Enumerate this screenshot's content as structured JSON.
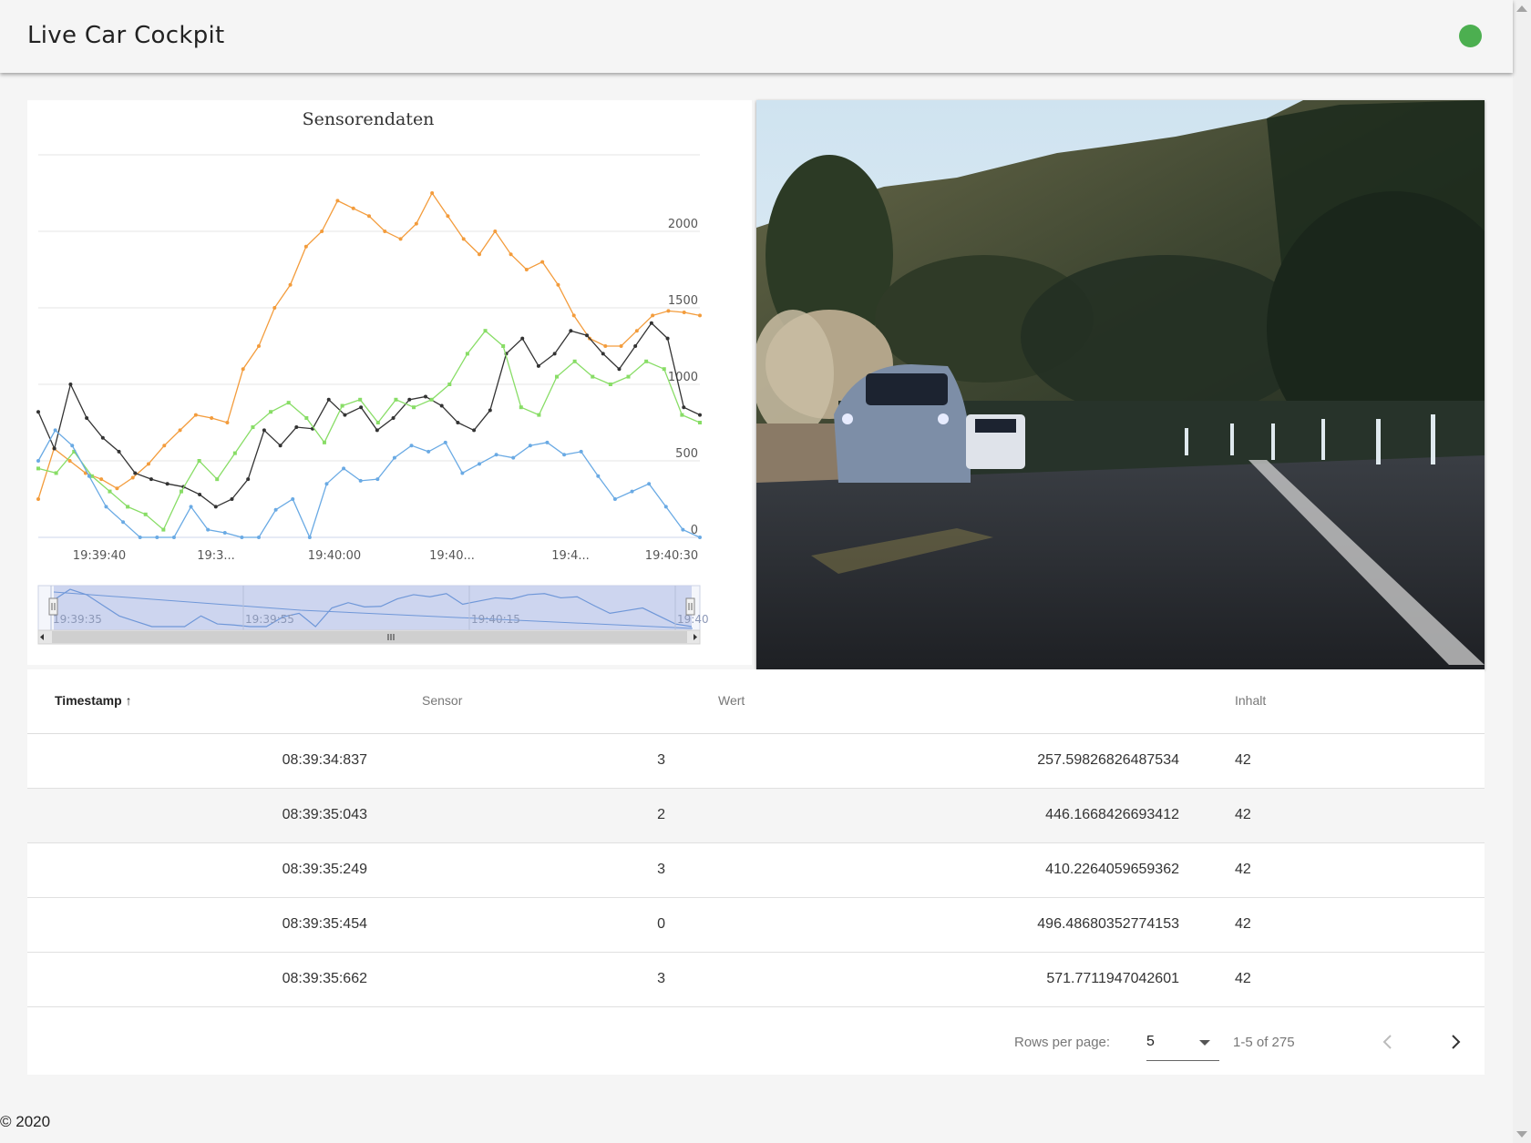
{
  "app": {
    "title": "Live Car Cockpit",
    "status_color": "#4caf50"
  },
  "chart_data": {
    "type": "line",
    "title": "Sensorendaten",
    "xlabel": "",
    "ylabel": "",
    "y_ticks": [
      "0",
      "500",
      "1000",
      "1500",
      "2000"
    ],
    "x_ticks": [
      "19:39:40",
      "19:3...",
      "19:40:00",
      "19:40...",
      "19:4...",
      "19:40:30"
    ],
    "ylim": [
      0,
      2500
    ],
    "grid": true,
    "legend": "none",
    "series": [
      {
        "color": "#f39c3c",
        "values": [
          250,
          580,
          500,
          420,
          380,
          320,
          390,
          480,
          600,
          700,
          800,
          780,
          750,
          1100,
          1250,
          1500,
          1650,
          1900,
          2000,
          2200,
          2150,
          2100,
          2000,
          1950,
          2050,
          2250,
          2100,
          1950,
          1850,
          2000,
          1850,
          1750,
          1800,
          1650,
          1450,
          1300,
          1250,
          1250,
          1350,
          1450,
          1480,
          1470,
          1450
        ]
      },
      {
        "color": "#333333",
        "values": [
          820,
          580,
          1000,
          780,
          650,
          560,
          420,
          380,
          350,
          330,
          280,
          200,
          250,
          380,
          700,
          600,
          720,
          710,
          900,
          800,
          850,
          700,
          780,
          900,
          920,
          860,
          750,
          700,
          830,
          1200,
          1300,
          1120,
          1200,
          1350,
          1320,
          1200,
          1100,
          1250,
          1400,
          1300,
          850,
          800
        ]
      },
      {
        "color": "#88dd66",
        "values": [
          450,
          420,
          560,
          400,
          300,
          200,
          150,
          50,
          300,
          500,
          380,
          550,
          720,
          820,
          880,
          780,
          620,
          860,
          900,
          750,
          900,
          850,
          900,
          1000,
          1200,
          1350,
          1250,
          850,
          800,
          1050,
          1150,
          1050,
          1000,
          1050,
          1150,
          1100,
          800,
          750
        ]
      },
      {
        "color": "#6aaae4",
        "values": [
          500,
          700,
          600,
          400,
          200,
          100,
          0,
          0,
          0,
          200,
          50,
          30,
          0,
          0,
          180,
          250,
          0,
          350,
          450,
          370,
          380,
          520,
          600,
          560,
          620,
          420,
          480,
          540,
          520,
          600,
          620,
          540,
          560,
          400,
          250,
          300,
          350,
          200,
          50,
          0
        ]
      }
    ]
  },
  "navigator": {
    "labels": [
      "19:39:35",
      "19:39:55",
      "19:40:15",
      "19:40"
    ]
  },
  "camera": {
    "alt": "Frontkamera"
  },
  "table": {
    "headers": {
      "timestamp": "Timestamp",
      "sensor": "Sensor",
      "wert": "Wert",
      "inhalt": "Inhalt"
    },
    "rows": [
      {
        "timestamp": "08:39:34:837",
        "sensor": "3",
        "wert": "257.59826826487534",
        "inhalt": "42"
      },
      {
        "timestamp": "08:39:35:043",
        "sensor": "2",
        "wert": "446.1668426693412",
        "inhalt": "42"
      },
      {
        "timestamp": "08:39:35:249",
        "sensor": "3",
        "wert": "410.2264059659362",
        "inhalt": "42"
      },
      {
        "timestamp": "08:39:35:454",
        "sensor": "0",
        "wert": "496.48680352774153",
        "inhalt": "42"
      },
      {
        "timestamp": "08:39:35:662",
        "sensor": "3",
        "wert": "571.7711947042601",
        "inhalt": "42"
      }
    ]
  },
  "pagination": {
    "rows_per_page_label": "Rows per page:",
    "rows_per_page": "5",
    "range": "1-5 of 275"
  },
  "footer": {
    "copyright": "© 2020"
  }
}
